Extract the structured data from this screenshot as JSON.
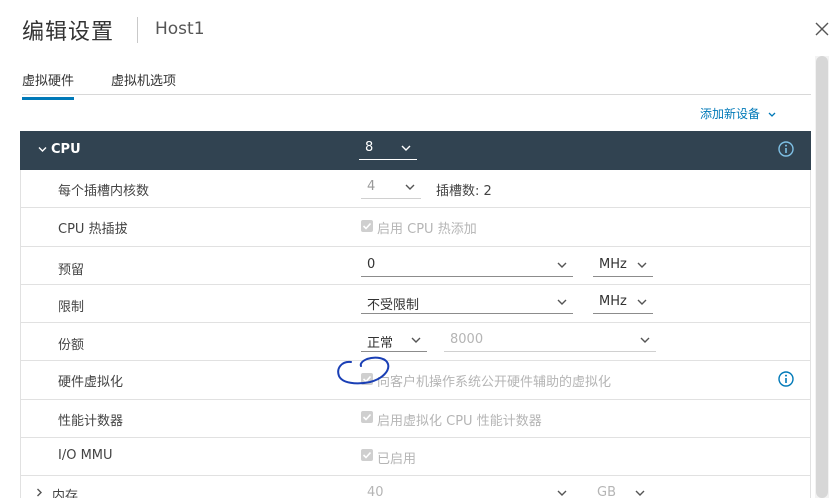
{
  "dialog": {
    "title": "编辑设置",
    "subtitle": "Host1"
  },
  "tabs": [
    {
      "label": "虚拟硬件",
      "active": true
    },
    {
      "label": "虚拟机选项",
      "active": false
    }
  ],
  "toolbar": {
    "add_device_label": "添加新设备"
  },
  "cpu": {
    "header_label": "CPU",
    "count_value": "8",
    "rows": {
      "cores_per_socket": {
        "label": "每个插槽内核数",
        "value": "4",
        "sockets_text": "插槽数: 2"
      },
      "hot_plug": {
        "label": "CPU 热插拔",
        "checkbox_label": "启用 CPU 热添加",
        "checked": true,
        "enabled": false
      },
      "reservation": {
        "label": "预留",
        "value": "0",
        "unit": "MHz"
      },
      "limit": {
        "label": "限制",
        "value": "不受限制",
        "unit": "MHz"
      },
      "shares": {
        "label": "份额",
        "level": "正常",
        "value": "8000"
      },
      "hw_virtualization": {
        "label": "硬件虚拟化",
        "checkbox_label": "向客户机操作系统公开硬件辅助的虚拟化",
        "checked": true,
        "enabled": false
      },
      "perf_counters": {
        "label": "性能计数器",
        "checkbox_label": "启用虚拟化 CPU 性能计数器",
        "checked": true,
        "enabled": false
      },
      "iommu": {
        "label": "I/O MMU",
        "checkbox_label": "已启用",
        "checked": true,
        "enabled": false
      }
    }
  },
  "memory": {
    "header_label": "内存",
    "value": "40",
    "unit": "GB"
  },
  "colors": {
    "accent": "#0079b8",
    "header_bg": "#314351",
    "annotation": "#1a3fb5"
  }
}
